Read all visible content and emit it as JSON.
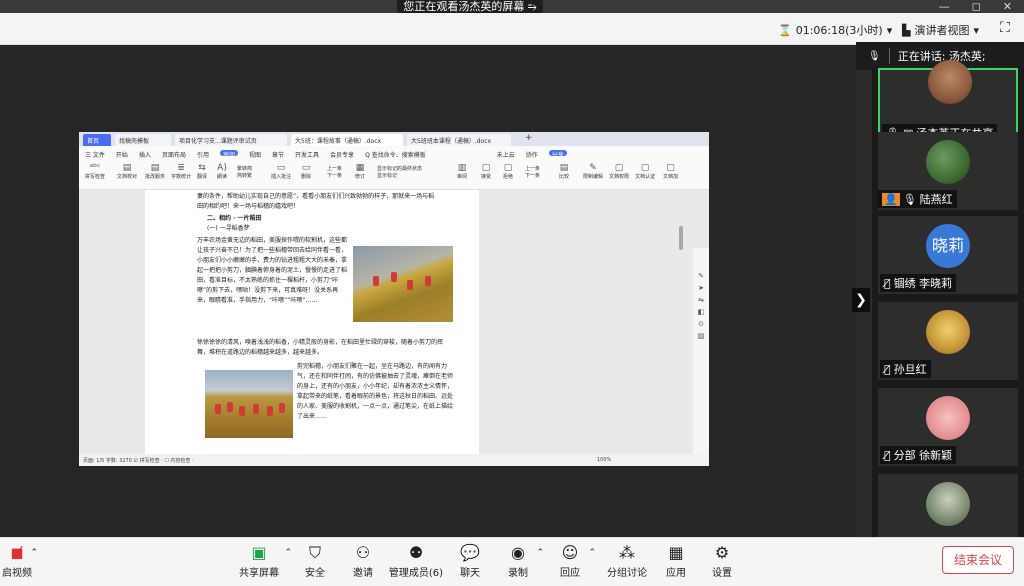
{
  "banner": {
    "text": "您正在观看汤杰英的屏幕",
    "button_icon": "screen-options-icon"
  },
  "window_controls": {
    "minimize": "—",
    "restore": "◻",
    "close": "✕"
  },
  "topbar": {
    "duration": "01:06:18(3小时)",
    "view_label": "演讲者视图",
    "fullscreen": "⛶"
  },
  "speaking": {
    "label": "正在讲话: 汤杰英;"
  },
  "participants": [
    {
      "name": "汤杰英正在共享",
      "active": true
    },
    {
      "name": "陆燕红"
    },
    {
      "name": "锢绣 李晓莉",
      "avatar_text": "晓莉"
    },
    {
      "name": "孙旦红"
    },
    {
      "name": "分部 徐新颖"
    },
    {
      "name": ""
    }
  ],
  "toolbar": {
    "video": "启视频",
    "share": "共享屏幕",
    "security": "安全",
    "invite": "邀请",
    "members": "管理成员(6)",
    "chat": "聊天",
    "record": "录制",
    "reaction": "回应",
    "breakout": "分组讨论",
    "apps": "应用",
    "settings": "设置",
    "end": "结束会议"
  },
  "shared": {
    "tabs": [
      "首页",
      "找稿壳模板",
      "项目化学习支...课题评审试页",
      "大5班：课程故事（通稿）.docx",
      "大5班班本课程（通稿）.docx"
    ],
    "menu": [
      "三 文件",
      "开始",
      "插入",
      "页面布局",
      "引用",
      "审阅",
      "视图",
      "章节",
      "开发工具",
      "会员专享",
      "Q 查找命令、搜索模板",
      "未上云",
      "协作",
      "分享"
    ],
    "ribbon": [
      "拼写检查",
      "文档校对",
      "批改服务",
      "字数统计",
      "翻译",
      "朗读",
      "繁转简",
      "简转繁",
      "插入批注",
      "删除",
      "上一条",
      "下一条",
      "修订",
      "显示标记的最终状态",
      "显示标记",
      "审阅",
      "接受",
      "拒绝",
      "上一条",
      "下一条",
      "比较",
      "限制编辑",
      "文档权限",
      "文档认证",
      "文档加"
    ],
    "doc": {
      "intro": "妻的条件，帮助幼儿实现自己的意愿”，看看小朋友们们兴致勃勃的样子，那就来一场与稻田的相约吧！来一场与稻穗的嬉戏吧！",
      "h2": "二、相约 · 一片稻田",
      "h3": "(一) 一寻稻香梦",
      "p1": "万丰农场金黄无边的稻田，美服探作喂的软割机，这些都让孩子兴奋不已！为了把一些稻穗带回去给同伴看一看，小朋友们小小嫩嫩的手，费力的钻进粗粗大大的禾秦，拿起一把把小剪刀，腼腆着俯身着的泥土，慢慢的走进了稻田，看准目标，不太熟练的抓住一棵稻杆，小剪刀“咔嚓”的剪下去，嘿呦！没剪下来，可真难呀！没关系再来，眼睛看准，手指用力，“咔嚓”“咔嚓”……",
      "p2": "徐徐徐徐的清风，嗅着浅浅的稻香，小精灵般的身影，在稻田里忙碌的穿梭，随着小剪刀的挥舞，堆积在道路边的稻穗越来越多，越来越多。",
      "p3": "剪完稻穗，小朋友们聚在一起，坐在马路边，有的闻有力气，还在和同伴打闹，有的仿佛被抽去了灵魂，瘫倒在老师的身上，还有的小朋友，小小年纪，却有着浓浓主义情怀，拿起带来的纸笔，看着眼前的景色，将这秋日的稻田、远处的人家、美服的收割机，一点一点，通过笔尖，在纸上描绘了出来……"
    },
    "status": "页面: 1/5   字数: 3270   ☑ 拼写检查 ·   ☐ 内容检查 ·",
    "zoom": "100%"
  }
}
